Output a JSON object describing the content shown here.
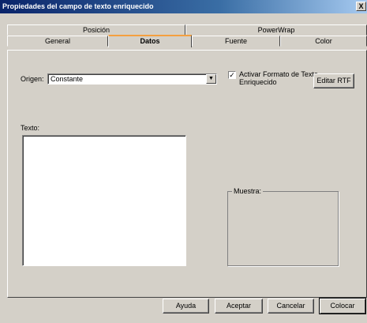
{
  "window": {
    "title": "Propiedades del campo de texto enriquecido",
    "close_label": "X"
  },
  "tabs": {
    "row1": [
      {
        "label": "Posición"
      },
      {
        "label": "PowerWrap"
      }
    ],
    "row2": [
      {
        "label": "General"
      },
      {
        "label": "Datos",
        "active": true
      },
      {
        "label": "Fuente"
      },
      {
        "label": "Color"
      }
    ]
  },
  "datos": {
    "origen_label": "Origen:",
    "origen_value": "Constante",
    "texto_label": "Texto:",
    "texto_value": "",
    "rtf_checkbox_label_line1": "Activar Formato de Texto",
    "rtf_checkbox_label_line2": "Enriquecido",
    "rtf_checked": true,
    "edit_rtf_button": "Editar RTF",
    "preview_label": "Muestra:"
  },
  "footer": {
    "help": "Ayuda",
    "ok": "Aceptar",
    "cancel": "Cancelar",
    "place": "Colocar"
  }
}
